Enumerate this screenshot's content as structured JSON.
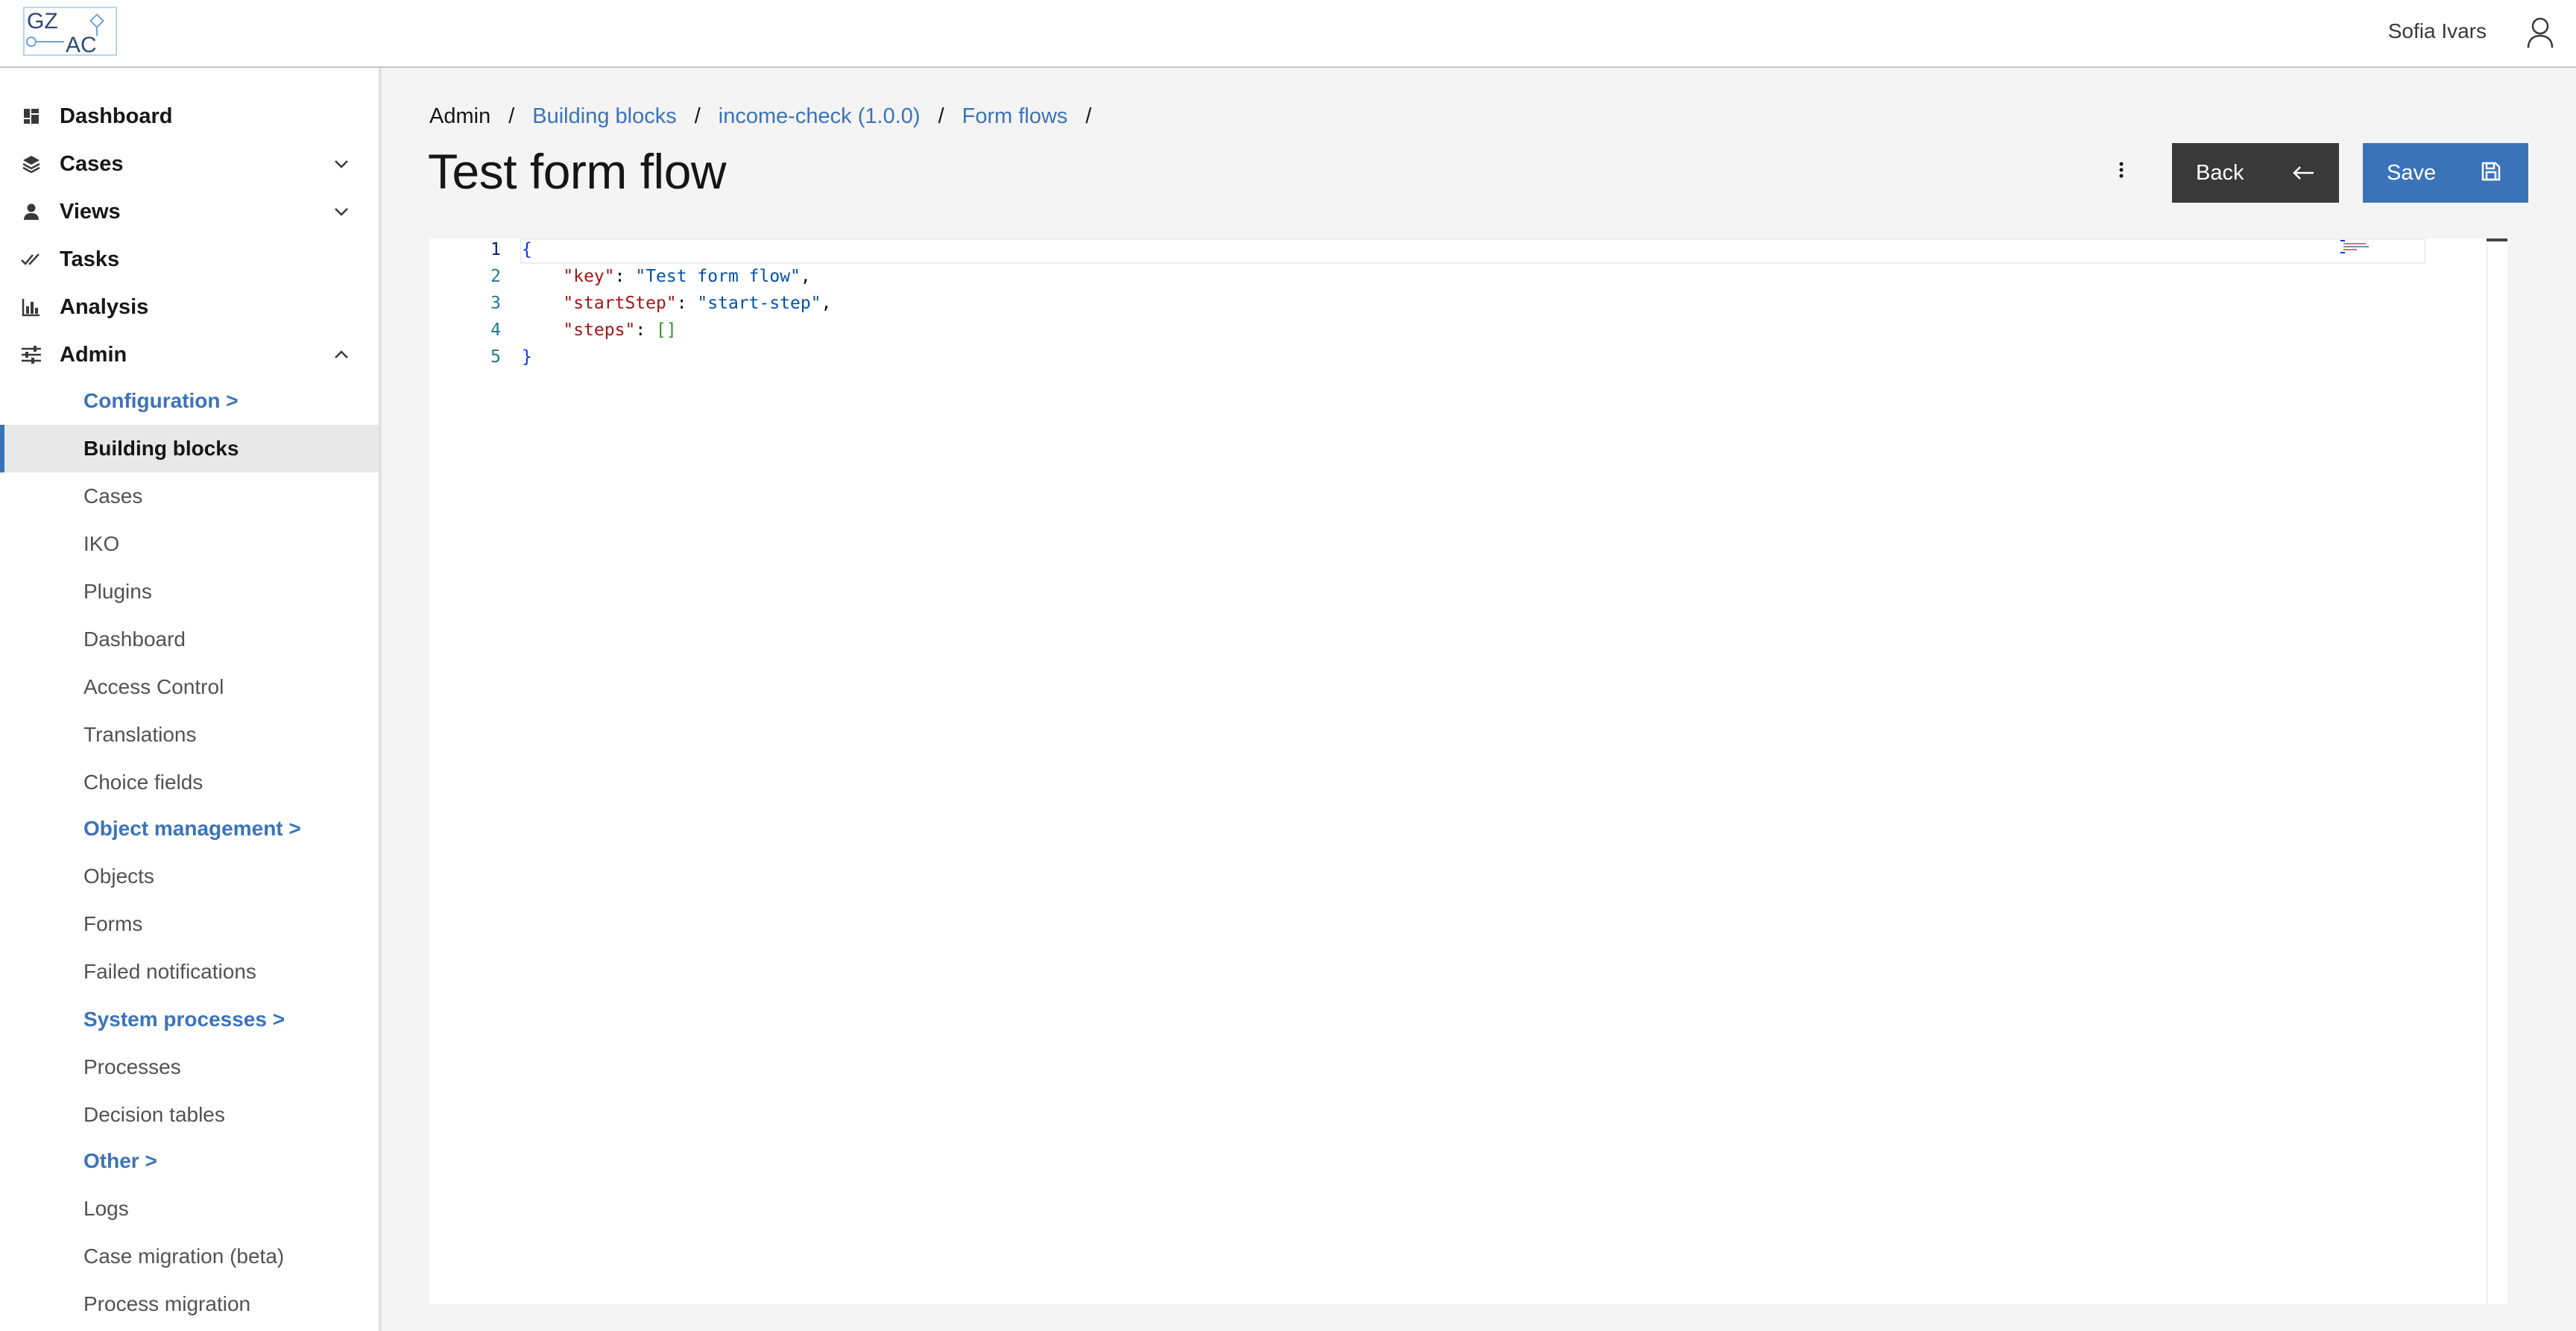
{
  "header": {
    "logo_text_top": "GZ",
    "logo_text_bottom": "AC",
    "user_name": "Sofia Ivars"
  },
  "sidebar": {
    "top_items": [
      {
        "label": "Dashboard",
        "icon": "dashboard-icon"
      },
      {
        "label": "Cases",
        "icon": "layers-icon"
      },
      {
        "label": "Views",
        "icon": "person-icon"
      },
      {
        "label": "Tasks",
        "icon": "checkmarks-icon"
      },
      {
        "label": "Analysis",
        "icon": "bar-chart-icon"
      },
      {
        "label": "Admin",
        "icon": "settings-adjust-icon"
      }
    ],
    "admin_items": [
      {
        "label": "Configuration >",
        "group": true
      },
      {
        "label": "Building blocks",
        "active": true
      },
      {
        "label": "Cases"
      },
      {
        "label": "IKO"
      },
      {
        "label": "Plugins"
      },
      {
        "label": "Dashboard"
      },
      {
        "label": "Access Control"
      },
      {
        "label": "Translations"
      },
      {
        "label": "Choice fields"
      },
      {
        "label": "Object management >",
        "group": true
      },
      {
        "label": "Objects"
      },
      {
        "label": "Forms"
      },
      {
        "label": "Failed notifications"
      },
      {
        "label": "System processes >",
        "group": true
      },
      {
        "label": "Processes"
      },
      {
        "label": "Decision tables"
      },
      {
        "label": "Other >",
        "group": true
      },
      {
        "label": "Logs"
      },
      {
        "label": "Case migration (beta)"
      },
      {
        "label": "Process migration"
      }
    ]
  },
  "breadcrumb": [
    "Admin",
    "Building blocks",
    "income-check (1.0.0)",
    "Form flows"
  ],
  "page": {
    "title": "Test form flow",
    "back_label": "Back",
    "save_label": "Save"
  },
  "editor": {
    "line_numbers": [
      "1",
      "2",
      "3",
      "4",
      "5"
    ],
    "lines": [
      {
        "open": "{"
      },
      {
        "key": "\"key\"",
        "colon": ": ",
        "value": "\"Test form flow\"",
        "comma": ","
      },
      {
        "key": "\"startStep\"",
        "colon": ": ",
        "value": "\"start-step\"",
        "comma": ","
      },
      {
        "key": "\"steps\"",
        "colon": ": ",
        "array": "[]"
      },
      {
        "close": "}"
      }
    ]
  },
  "colors": {
    "accent": "#3b73b9",
    "dark_button": "#393939"
  }
}
